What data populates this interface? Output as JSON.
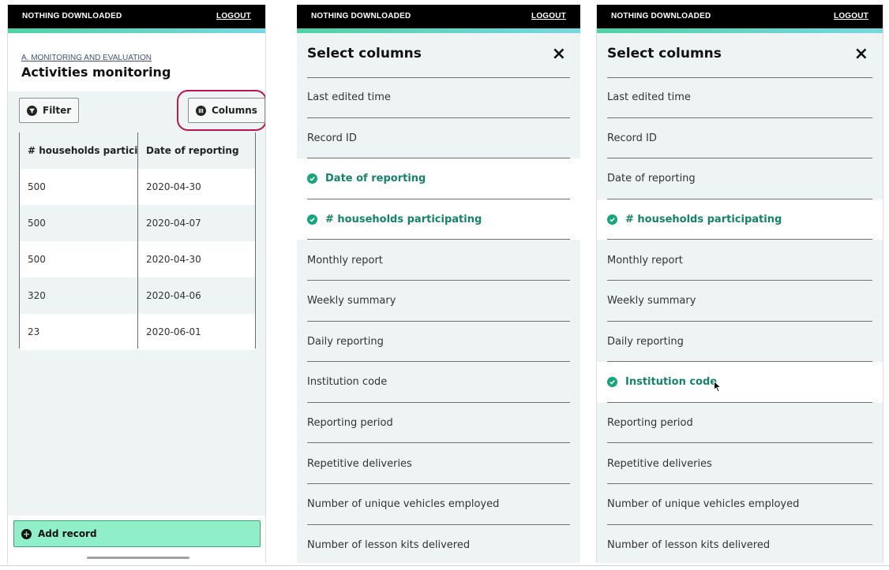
{
  "status": "NOTHING DOWNLOADED",
  "logout": "LOGOUT",
  "screen1": {
    "breadcrumb": "A. MONITORING AND EVALUATION",
    "title": "Activities monitoring",
    "filter_label": "Filter",
    "columns_label": "Columns",
    "table": {
      "headers": [
        "# households partici...",
        "Date of reporting"
      ],
      "rows": [
        [
          "500",
          "2020-04-30"
        ],
        [
          "500",
          "2020-04-07"
        ],
        [
          "500",
          "2020-04-30"
        ],
        [
          "320",
          "2020-04-06"
        ],
        [
          "23",
          "2020-06-01"
        ]
      ]
    },
    "add_record": "Add record"
  },
  "panel_title": "Select columns",
  "close_icon": "×",
  "panel2_items": [
    {
      "label": "Last edited time",
      "selected": false
    },
    {
      "label": "Record ID",
      "selected": false
    },
    {
      "label": "Date of reporting",
      "selected": true
    },
    {
      "label": "# households participating",
      "selected": true
    },
    {
      "label": "Monthly report",
      "selected": false
    },
    {
      "label": "Weekly summary",
      "selected": false
    },
    {
      "label": "Daily reporting",
      "selected": false
    },
    {
      "label": "Institution code",
      "selected": false
    },
    {
      "label": "Reporting period",
      "selected": false
    },
    {
      "label": "Repetitive deliveries",
      "selected": false
    },
    {
      "label": "Number of unique vehicles employed",
      "selected": false
    },
    {
      "label": "Number of lesson kits delivered",
      "selected": false
    }
  ],
  "panel3_items": [
    {
      "label": "Last edited time",
      "selected": false
    },
    {
      "label": "Record ID",
      "selected": false
    },
    {
      "label": "Date of reporting",
      "selected": false
    },
    {
      "label": "# households participating",
      "selected": true
    },
    {
      "label": "Monthly report",
      "selected": false
    },
    {
      "label": "Weekly summary",
      "selected": false
    },
    {
      "label": "Daily reporting",
      "selected": false
    },
    {
      "label": "Institution code",
      "selected": true
    },
    {
      "label": "Reporting period",
      "selected": false
    },
    {
      "label": "Repetitive deliveries",
      "selected": false
    },
    {
      "label": "Number of unique vehicles employed",
      "selected": false
    },
    {
      "label": "Number of lesson kits delivered",
      "selected": false
    }
  ],
  "colors": {
    "accent": "#4fd1a5",
    "selected_text": "#15836a",
    "check": "#15a57c",
    "add_button": "#90efc9",
    "annotation": "#b8174f"
  }
}
